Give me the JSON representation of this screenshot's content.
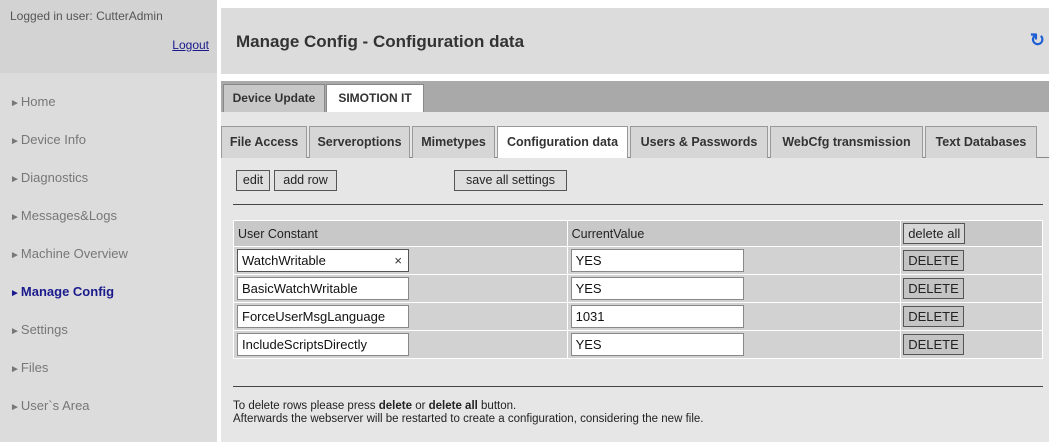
{
  "login": {
    "user_text": "Logged in user: CutterAdmin",
    "logout_label": "Logout"
  },
  "nav": {
    "arrow": "►",
    "items": [
      {
        "label": "Home"
      },
      {
        "label": "Device Info"
      },
      {
        "label": "Diagnostics"
      },
      {
        "label": "Messages&Logs"
      },
      {
        "label": "Machine Overview"
      },
      {
        "label": "Manage Config",
        "active": true
      },
      {
        "label": "Settings"
      },
      {
        "label": "Files"
      },
      {
        "label": "User`s Area"
      }
    ]
  },
  "header": {
    "title": "Manage Config - Configuration data",
    "refresh_icon": "refresh-icon",
    "refresh_glyph": "↻"
  },
  "top_tabs": [
    {
      "label": "Device Update"
    },
    {
      "label": "SIMOTION IT",
      "selected": true
    }
  ],
  "sub_tabs": [
    {
      "label": "File Access"
    },
    {
      "label": "Serveroptions"
    },
    {
      "label": "Mimetypes"
    },
    {
      "label": "Configuration data",
      "selected": true
    },
    {
      "label": "Users & Passwords"
    },
    {
      "label": "WebCfg transmission"
    },
    {
      "label": "Text Databases"
    }
  ],
  "toolbar": {
    "edit_label": "edit",
    "add_row_label": "add row",
    "save_all_label": "save all settings"
  },
  "table": {
    "col_user_constant": "User Constant",
    "col_current_value": "CurrentValue",
    "delete_all_label": "delete all",
    "delete_label": "DELETE",
    "rows": [
      {
        "constant": "WatchWritable",
        "value": "YES"
      },
      {
        "constant": "BasicWatchWritable",
        "value": "YES"
      },
      {
        "constant": "ForceUserMsgLanguage",
        "value": "1031"
      },
      {
        "constant": "IncludeScriptsDirectly",
        "value": "YES"
      }
    ]
  },
  "footer": {
    "line1_a": "To delete rows please press ",
    "line1_b": "delete",
    "line1_c": " or ",
    "line1_d": "delete all",
    "line1_e": " button.",
    "line2": "Afterwards the webserver will be restarted to create a configuration, considering the new file."
  },
  "colors": {
    "accent": "#1a1a8c",
    "refresh": "#1f5fd6"
  }
}
